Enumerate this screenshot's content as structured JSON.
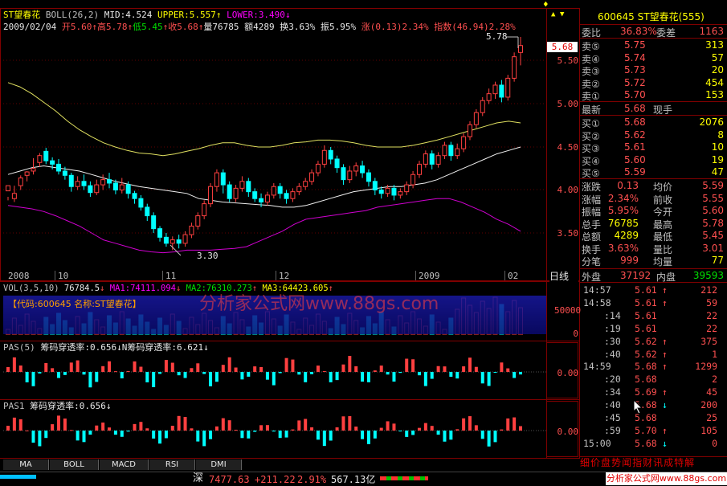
{
  "top_icons": {
    "up": "▲",
    "down": "▼",
    "pin": "♦"
  },
  "header": {
    "name": "ST望春花",
    "indicator": "BOLL(26,2)",
    "mid": "MID:4.524",
    "upper": "UPPER:5.557",
    "lower": "LOWER:3.490",
    "date": "2009/02/04",
    "open": "开5.60",
    "high": "高5.78",
    "low": "低5.45",
    "close": "收5.68",
    "volume": "量76785",
    "amount": "额4289",
    "turnover": "换3.63%",
    "amplitude": "振5.95%",
    "change": "涨(0.13)2.34%",
    "index": "指数(46.94)2.28%"
  },
  "chart_marks": {
    "high": "5.78",
    "low": "3.30",
    "current_tag": "5.68"
  },
  "chart_data": {
    "type": "candlestick",
    "y_ticks": [
      "5.50",
      "5.00",
      "4.50",
      "4.00",
      "3.50"
    ],
    "x_ticks": [
      "2008",
      "10",
      "11",
      "12",
      "2009",
      "02"
    ],
    "candles": [
      [
        3.99,
        4.05,
        3.92,
        3.88
      ],
      [
        3.9,
        3.96,
        4.05,
        3.86
      ],
      [
        4.05,
        4.14,
        4.17,
        4.0
      ],
      [
        4.17,
        4.21,
        4.22,
        4.1
      ],
      [
        4.22,
        4.25,
        4.37,
        4.18
      ],
      [
        4.32,
        4.4,
        4.43,
        4.27
      ],
      [
        4.45,
        4.34,
        4.49,
        4.3
      ],
      [
        4.34,
        4.3,
        4.38,
        4.24
      ],
      [
        4.3,
        4.22,
        4.36,
        4.18
      ],
      [
        4.22,
        4.17,
        4.27,
        4.12
      ],
      [
        4.17,
        4.04,
        4.2,
        3.98
      ],
      [
        4.04,
        4.1,
        4.16,
        4.0
      ],
      [
        4.1,
        4.05,
        4.18,
        4.0
      ],
      [
        4.05,
        3.97,
        4.1,
        3.92
      ],
      [
        3.97,
        4.06,
        4.12,
        3.94
      ],
      [
        4.06,
        4.12,
        4.18,
        4.0
      ],
      [
        4.12,
        4.08,
        4.2,
        4.02
      ],
      [
        4.08,
        4.0,
        4.12,
        3.95
      ],
      [
        4.0,
        4.06,
        4.14,
        3.96
      ],
      [
        4.06,
        3.96,
        4.1,
        3.9
      ],
      [
        3.96,
        3.9,
        3.99,
        3.84
      ],
      [
        3.9,
        3.8,
        3.94,
        3.76
      ],
      [
        3.8,
        3.7,
        3.84,
        3.64
      ],
      [
        3.7,
        3.55,
        3.74,
        3.5
      ],
      [
        3.55,
        3.45,
        3.58,
        3.4
      ],
      [
        3.45,
        3.38,
        3.5,
        3.34
      ],
      [
        3.38,
        3.42,
        3.46,
        3.3
      ],
      [
        3.42,
        3.38,
        3.48,
        3.32
      ],
      [
        3.38,
        3.48,
        3.52,
        3.34
      ],
      [
        3.48,
        3.58,
        3.62,
        3.44
      ],
      [
        3.58,
        3.7,
        3.74,
        3.54
      ],
      [
        3.7,
        3.84,
        3.88,
        3.66
      ],
      [
        3.84,
        4.04,
        4.08,
        3.8
      ],
      [
        4.04,
        4.2,
        4.24,
        3.98
      ],
      [
        4.2,
        4.06,
        4.24,
        3.96
      ],
      [
        4.06,
        3.9,
        4.1,
        3.86
      ],
      [
        3.9,
        4.02,
        4.06,
        3.86
      ],
      [
        4.02,
        4.1,
        4.16,
        3.98
      ],
      [
        4.1,
        3.98,
        4.14,
        3.92
      ],
      [
        3.98,
        3.9,
        4.02,
        3.86
      ],
      [
        3.9,
        3.86,
        3.96,
        3.8
      ],
      [
        3.86,
        3.94,
        3.98,
        3.82
      ],
      [
        3.94,
        4.04,
        4.08,
        3.9
      ],
      [
        4.04,
        3.96,
        4.08,
        3.9
      ],
      [
        3.96,
        3.9,
        4.0,
        3.84
      ],
      [
        3.9,
        3.98,
        4.02,
        3.86
      ],
      [
        3.98,
        4.04,
        4.08,
        3.94
      ],
      [
        4.04,
        4.1,
        4.14,
        4.0
      ],
      [
        4.1,
        4.2,
        4.24,
        4.06
      ],
      [
        4.2,
        4.3,
        4.34,
        4.16
      ],
      [
        4.3,
        4.46,
        4.52,
        4.26
      ],
      [
        4.46,
        4.36,
        4.5,
        4.3
      ],
      [
        4.36,
        4.26,
        4.4,
        4.2
      ],
      [
        4.26,
        4.12,
        4.3,
        4.06
      ],
      [
        4.12,
        4.22,
        4.28,
        4.08
      ],
      [
        4.22,
        4.28,
        4.32,
        4.16
      ],
      [
        4.28,
        4.2,
        4.34,
        4.14
      ],
      [
        4.2,
        4.1,
        4.24,
        4.04
      ],
      [
        4.1,
        4.0,
        4.14,
        3.94
      ],
      [
        4.0,
        3.96,
        4.04,
        3.9
      ],
      [
        3.96,
        4.02,
        4.06,
        3.92
      ],
      [
        4.02,
        3.94,
        4.06,
        3.88
      ],
      [
        3.94,
        3.98,
        4.02,
        3.9
      ],
      [
        3.98,
        4.06,
        4.1,
        3.94
      ],
      [
        4.06,
        4.18,
        4.22,
        4.02
      ],
      [
        4.18,
        4.3,
        4.34,
        4.14
      ],
      [
        4.3,
        4.42,
        4.46,
        4.26
      ],
      [
        4.42,
        4.3,
        4.46,
        4.24
      ],
      [
        4.3,
        4.4,
        4.44,
        4.26
      ],
      [
        4.4,
        4.52,
        4.56,
        4.36
      ],
      [
        4.52,
        4.4,
        4.56,
        4.34
      ],
      [
        4.4,
        4.48,
        4.54,
        4.36
      ],
      [
        4.48,
        4.62,
        4.66,
        4.44
      ],
      [
        4.62,
        4.76,
        4.8,
        4.58
      ],
      [
        4.76,
        4.9,
        4.94,
        4.72
      ],
      [
        4.9,
        5.04,
        5.08,
        4.86
      ],
      [
        5.04,
        5.12,
        5.18,
        5.0
      ],
      [
        5.12,
        5.22,
        5.26,
        5.06
      ],
      [
        5.22,
        5.08,
        5.28,
        5.02
      ],
      [
        5.08,
        5.3,
        5.34,
        5.04
      ],
      [
        5.3,
        5.55,
        5.6,
        5.26
      ],
      [
        5.6,
        5.68,
        5.78,
        5.45
      ]
    ],
    "upper_line": [
      5.25,
      5.2,
      5.12,
      5.02,
      4.92,
      4.8,
      4.7,
      4.62,
      4.55,
      4.5,
      4.46,
      4.43,
      4.42,
      4.4,
      4.42,
      4.45,
      4.48,
      4.52,
      4.55,
      4.55,
      4.52,
      4.5,
      4.5,
      4.52,
      4.55,
      4.56,
      4.58,
      4.58,
      4.57,
      4.55,
      4.52,
      4.5,
      4.5,
      4.5,
      4.52,
      4.55,
      4.58,
      4.62,
      4.66,
      4.7,
      4.74,
      4.78,
      4.8,
      4.78
    ],
    "mid_line": [
      4.18,
      4.22,
      4.26,
      4.28,
      4.26,
      4.24,
      4.22,
      4.18,
      4.14,
      4.1,
      4.07,
      4.04,
      4.02,
      4.0,
      3.98,
      3.96,
      3.9,
      3.88,
      3.86,
      3.85,
      3.84,
      3.83,
      3.82,
      3.8,
      3.8,
      3.82,
      3.86,
      3.9,
      3.94,
      3.98,
      4.0,
      4.02,
      4.04,
      4.04,
      4.06,
      4.08,
      4.12,
      4.18,
      4.24,
      4.3,
      4.36,
      4.42,
      4.46,
      4.5
    ],
    "lower_line": [
      3.82,
      3.8,
      3.78,
      3.75,
      3.7,
      3.64,
      3.58,
      3.5,
      3.42,
      3.38,
      3.34,
      3.3,
      3.28,
      3.27,
      3.28,
      3.3,
      3.3,
      3.3,
      3.31,
      3.32,
      3.34,
      3.4,
      3.46,
      3.52,
      3.6,
      3.66,
      3.68,
      3.7,
      3.72,
      3.74,
      3.76,
      3.8,
      3.82,
      3.84,
      3.86,
      3.88,
      3.9,
      3.9,
      3.86,
      3.8,
      3.74,
      3.66,
      3.6,
      3.52
    ]
  },
  "vol": {
    "title": "VOL(3,5,10)",
    "value": "76784.5",
    "ma1": "MA1:74111.094",
    "ma2": "MA2:76310.273",
    "ma3": "MA3:64423.605",
    "stock_label": "【代码:600645 名称:ST望春花】",
    "watermark": "分析家公式网www.88gs.com",
    "y_ticks": [
      "50000",
      "0"
    ]
  },
  "pas5": {
    "label": "PAS(5)",
    "text1": "筹码穿透率:0.656",
    "text2": "N筹码穿透率:6.621",
    "zero": "0.00"
  },
  "pas1": {
    "label": "PAS1",
    "text": "筹码穿透率:0.656",
    "zero": "0.00"
  },
  "bottom_tabs": [
    "MA",
    "BOLL",
    "MACD",
    "RSI",
    "DMI"
  ],
  "status_bar": {
    "market": "深",
    "index": "7477.63",
    "change": "+211.22",
    "pct": "2.91%",
    "amount": "567.13亿",
    "footer_site": "分析家公式网www.88gs.com"
  },
  "right_panel": {
    "code": "600645",
    "name": "ST望春花",
    "count": "(555)",
    "weibi_label": "委比",
    "weibi": "36.83%",
    "weicha_label": "委差",
    "weicha": "1163",
    "asks": [
      {
        "label": "卖⑤",
        "price": "5.75",
        "vol": "313"
      },
      {
        "label": "卖④",
        "price": "5.74",
        "vol": "57"
      },
      {
        "label": "卖③",
        "price": "5.73",
        "vol": "20"
      },
      {
        "label": "卖②",
        "price": "5.72",
        "vol": "454"
      },
      {
        "label": "卖①",
        "price": "5.70",
        "vol": "153"
      }
    ],
    "last_label": "最新",
    "last": "5.68",
    "hand_label": "现手",
    "bids": [
      {
        "label": "买①",
        "price": "5.68",
        "vol": "2076"
      },
      {
        "label": "买②",
        "price": "5.62",
        "vol": "8"
      },
      {
        "label": "买③",
        "price": "5.61",
        "vol": "10"
      },
      {
        "label": "买④",
        "price": "5.60",
        "vol": "19"
      },
      {
        "label": "买⑤",
        "price": "5.59",
        "vol": "47"
      }
    ],
    "stats": [
      {
        "l1": "涨跌",
        "v1": "0.13",
        "l2": "均价",
        "v2": "5.59"
      },
      {
        "l1": "涨幅",
        "v1": "2.34%",
        "l2": "前收",
        "v2": "5.55"
      },
      {
        "l1": "振幅",
        "v1": "5.95%",
        "l2": "今开",
        "v2": "5.60"
      },
      {
        "l1": "总手",
        "v1": "76785",
        "l2": "最高",
        "v2": "5.78"
      },
      {
        "l1": "总额",
        "v1": "4289",
        "l2": "最低",
        "v2": "5.45"
      },
      {
        "l1": "换手",
        "v1": "3.63%",
        "l2": "量比",
        "v2": "3.01"
      },
      {
        "l1": "分笔",
        "v1": "999",
        "l2": "均量",
        "v2": "77"
      }
    ],
    "outer_label": "外盘",
    "outer": "37192",
    "inner_label": "内盘",
    "inner": "39593",
    "ticks": [
      {
        "t": "14:57",
        "p": "5.61",
        "a": "↑",
        "v": "212"
      },
      {
        "t": "14:58",
        "p": "5.61",
        "a": "↑",
        "v": "59"
      },
      {
        "t": ":14",
        "p": "5.61",
        "a": "",
        "v": "22"
      },
      {
        "t": ":19",
        "p": "5.61",
        "a": "",
        "v": "22"
      },
      {
        "t": ":30",
        "p": "5.62",
        "a": "↑",
        "v": "375"
      },
      {
        "t": ":40",
        "p": "5.62",
        "a": "↑",
        "v": "1"
      },
      {
        "t": "14:59",
        "p": "5.68",
        "a": "↑",
        "v": "1299"
      },
      {
        "t": ":20",
        "p": "5.68",
        "a": "",
        "v": "2"
      },
      {
        "t": ":34",
        "p": "5.69",
        "a": "↑",
        "v": "45"
      },
      {
        "t": ":40",
        "p": "5.68",
        "a": "↓",
        "v": "200"
      },
      {
        "t": ":45",
        "p": "5.68",
        "a": "",
        "v": "25"
      },
      {
        "t": ":59",
        "p": "5.70",
        "a": "↑",
        "v": "105"
      },
      {
        "t": "15:00",
        "p": "5.68",
        "a": "↓",
        "v": "0"
      }
    ],
    "day_label": "日线",
    "bottom_tabs": [
      "细",
      "价",
      "盘",
      "势",
      "闻",
      "指",
      "财",
      "讯",
      "成",
      "特",
      "解"
    ]
  }
}
